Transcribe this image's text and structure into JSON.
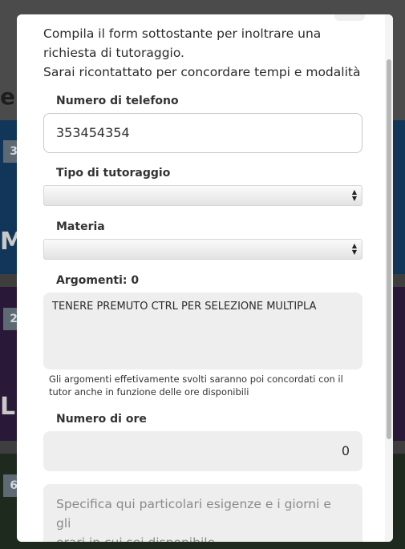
{
  "background": {
    "badges": [
      "3",
      "2",
      "6"
    ],
    "partial_letters": [
      "M",
      "L"
    ],
    "partial_heading": "e."
  },
  "form": {
    "intro_lines": [
      "Compila il form sottostante per inoltrare una",
      "richiesta di tutoraggio.",
      "Sarai ricontattato per concordare tempi e modalità"
    ],
    "phone": {
      "label": "Numero di telefono",
      "value": "353454354"
    },
    "tutoring_type": {
      "label": "Tipo di tutoraggio",
      "value": ""
    },
    "subject": {
      "label": "Materia",
      "value": ""
    },
    "topics": {
      "label": "Argomenti: 0",
      "option_hint": "TENERE PREMUTO CTRL PER SELEZIONE MULTIPLA",
      "note_lines": [
        "Gli argomenti effetivamente svolti saranno poi concordati con il",
        "tutor anche in funzione delle ore disponibili"
      ]
    },
    "hours": {
      "label": "Numero di ore",
      "value": "0"
    },
    "notes": {
      "placeholder_lines": [
        "Specifica qui particolari esigenze e i giorni e gli",
        "orari in cui sei disponibile"
      ]
    }
  },
  "colors": {
    "bg_blue": "#12365a",
    "bg_purple": "#2a1838",
    "field_grey": "#eeeeee"
  }
}
